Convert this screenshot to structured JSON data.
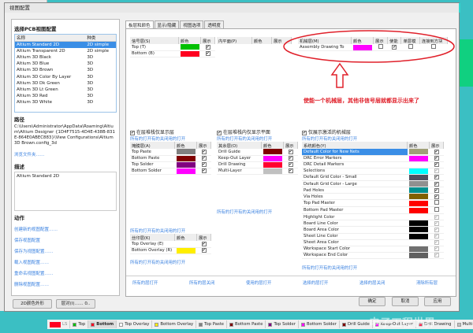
{
  "window": {
    "title": "视图配置"
  },
  "left": {
    "select_title": "选择PCB视图配置",
    "list_headers": [
      "名称",
      "种类"
    ],
    "configs": [
      [
        "Altium Standard 2D",
        "2D simple"
      ],
      [
        "Altium Transparent 2D",
        "2D simple"
      ],
      [
        "Altium 3D Black",
        "3D"
      ],
      [
        "Altium 3D Blue",
        "3D"
      ],
      [
        "Altium 3D Brown",
        "3D"
      ],
      [
        "Altium 3D Color By Layer",
        "3D"
      ],
      [
        "Altium 3D Dk Green",
        "3D"
      ],
      [
        "Altium 3D Lt Green",
        "3D"
      ],
      [
        "Altium 3D Red",
        "3D"
      ],
      [
        "Altium 3D White",
        "3D"
      ]
    ],
    "path_title": "路径",
    "path": "C:\\Users\\Administrator\\AppData\\Roaming\\Altium\\Altium Designer {1D4F7515-4D4E-438B-831E-864E0ABEC883}\\View Configurations\\Altium 3D Brown.config_3d",
    "browse": "浏览文件夹……",
    "desc_title": "描述",
    "desc": "Altium Standard 2D",
    "actions_title": "动作",
    "actions": [
      "创建新的视图配置……",
      "保存视图配置",
      "保存为视图配置……",
      "载入视图配置……",
      "重命名视图配置……",
      "删除视图配置……"
    ],
    "btn_2d": "2D颜色外形",
    "btn_layer": "层对(I)…… 0.."
  },
  "tabs": [
    "板层和颜色",
    "显示/隐藏",
    "视图选项",
    "透明度"
  ],
  "signal": {
    "headers": [
      "信号层(S)",
      "颜色",
      "展示"
    ],
    "rows": [
      {
        "name": "Top (T)",
        "color": "#00c000",
        "show": true
      },
      {
        "name": "Bottom (B)",
        "color": "#ff0020",
        "show": true
      }
    ]
  },
  "plane": {
    "headers": [
      "内平面(P)",
      "颜色",
      "展示"
    ]
  },
  "mech": {
    "headers": [
      "机械层(M)",
      "颜色",
      "展示",
      "使能",
      "单层模",
      "连接到方块"
    ],
    "rows": [
      {
        "name": "Assembly Drawing To",
        "color": "#ff00ff",
        "show": false,
        "enable": true,
        "single": false,
        "linked": false
      }
    ]
  },
  "annotation": "使能一个机械层，其他非信号层就都显示出来了",
  "check1": "在层堆栈仅显示层",
  "check2": "在层堆栈内仅显示平面",
  "check3": "仅展示激活的机械层",
  "toggle_link": "所有的打开有的关闭用的打开",
  "mask": {
    "headers": [
      "掩膜层(A)",
      "颜色",
      "展示"
    ],
    "rows": [
      {
        "name": "Top Paste",
        "color": "#808080",
        "show": true
      },
      {
        "name": "Bottom Paste",
        "color": "#800000",
        "show": true
      },
      {
        "name": "Top Solder",
        "color": "#800080",
        "show": true
      },
      {
        "name": "Bottom Solder",
        "color": "#ff00ff",
        "show": true
      }
    ]
  },
  "other": {
    "headers": [
      "其余层(O)",
      "颜色",
      "展示"
    ],
    "rows": [
      {
        "name": "Drill Guide",
        "color": "#800000",
        "show": true
      },
      {
        "name": "Keep-Out Layer",
        "color": "#ff00ff",
        "show": true
      },
      {
        "name": "Drill Drawing",
        "color": "#ff0030",
        "show": true
      },
      {
        "name": "Multi-Layer",
        "color": "#c0c0c0",
        "show": true
      }
    ]
  },
  "silk": {
    "headers": [
      "丝印层(K)",
      "颜色",
      "展示"
    ],
    "rows": [
      {
        "name": "Top Overlay (E)",
        "color": "#ffffff",
        "show": true
      },
      {
        "name": "Bottom Overlay (R)",
        "color": "#ffee00",
        "show": true
      }
    ]
  },
  "system": {
    "headers": [
      "系统颜色(Y)",
      "颜色",
      "展示"
    ],
    "rows": [
      {
        "name": "Default Color for New Nets",
        "color": "#a0a078",
        "show": true
      },
      {
        "name": "DRC Error Markers",
        "color": "#ff00ff",
        "show": true
      },
      {
        "name": "DRC Detail Markers",
        "color": "#ffffff",
        "show": true
      },
      {
        "name": "Selections",
        "color": "#00ffff",
        "show": true,
        "dis": true
      },
      {
        "name": "Default Grid Color - Small",
        "color": "#505060",
        "show": true
      },
      {
        "name": "Default Grid Color - Large",
        "color": "#909090",
        "show": true
      },
      {
        "name": "Pad Holes",
        "color": "#009090",
        "show": true
      },
      {
        "name": "Via Holes",
        "color": "#806000",
        "show": true
      },
      {
        "name": "Top Pad Master",
        "color": "#ff0000",
        "show": false
      },
      {
        "name": "Bottom Pad Master",
        "color": "#ff0000",
        "show": false
      },
      {
        "name": "Highlight Color",
        "color": "#ffffff",
        "show": true,
        "dis": true
      },
      {
        "name": "Board Line Color",
        "color": "#000000",
        "show": true,
        "dis": true
      },
      {
        "name": "Board Area Color",
        "color": "#000000",
        "show": true,
        "dis": true
      },
      {
        "name": "Sheet Line Color",
        "color": "#000000",
        "show": true,
        "dis": true
      },
      {
        "name": "Sheet Area Color",
        "color": "#ffffff",
        "show": true,
        "dis": true
      },
      {
        "name": "Workspace Start Color",
        "color": "#707070",
        "show": true,
        "dis": true
      },
      {
        "name": "Workspace End Color",
        "color": "#606060",
        "show": true,
        "dis": true
      }
    ]
  },
  "bottom_links": [
    "所有的层打开",
    "所有的层关闭",
    "使用的层打开",
    "选择的层打开",
    "选择的层关闭",
    "清除所有层"
  ],
  "buttons": {
    "ok": "确定",
    "cancel": "取消",
    "apply": "应用"
  },
  "status": {
    "ls": "LS",
    "items": [
      {
        "label": "Top",
        "color": "#00c000"
      },
      {
        "label": "Bottom",
        "color": "#ff0020"
      },
      {
        "label": "Top Overlay",
        "color": "#ffffff"
      },
      {
        "label": "Bottom Overlay",
        "color": "#ffee00"
      },
      {
        "label": "Top Paste",
        "color": "#808080"
      },
      {
        "label": "Bottom Paste",
        "color": "#800000"
      },
      {
        "label": "Top Solder",
        "color": "#800080"
      },
      {
        "label": "Bottom Solder",
        "color": "#ff00ff"
      },
      {
        "label": "Drill Guide",
        "color": "#800000"
      },
      {
        "label": "Keep-Out Layer",
        "color": "#ff00ff"
      },
      {
        "label": "Drill Drawing",
        "color": "#ff0030"
      },
      {
        "label": "Multi-Layer",
        "color": "#c0c0c0"
      }
    ]
  },
  "watermark": "电子工程世界"
}
